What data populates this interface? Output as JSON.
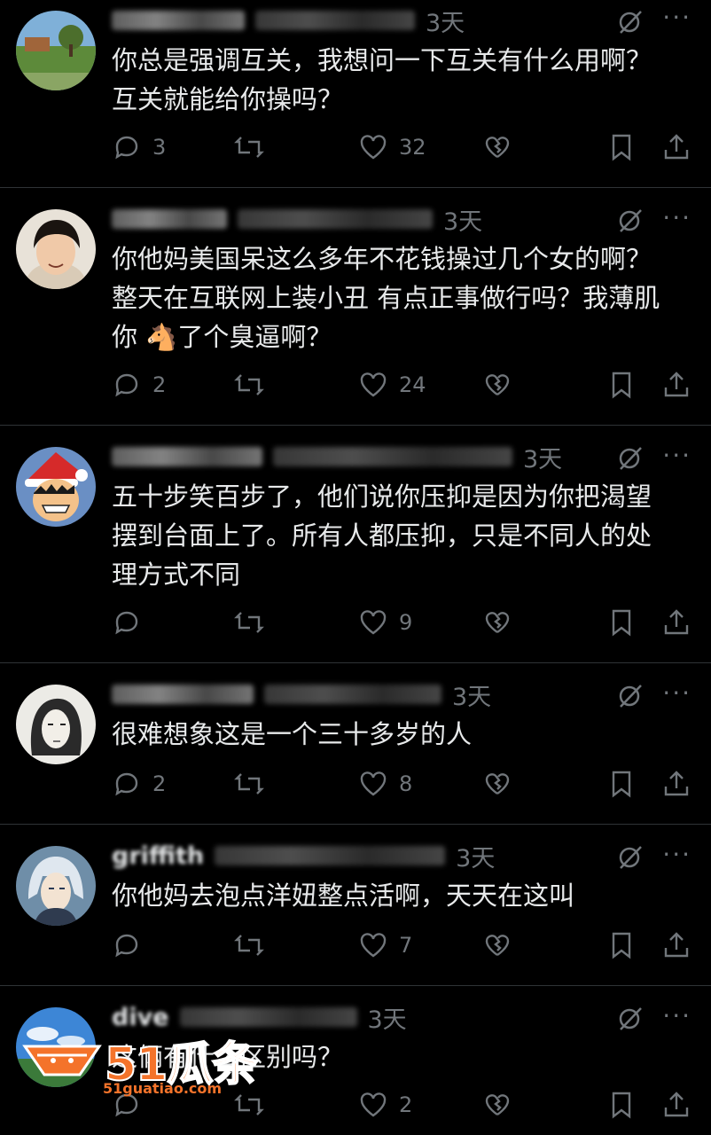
{
  "tweets": [
    {
      "time": "3天",
      "text": [
        "你总是强调互关，我想问一下互关有什么用啊？",
        "互关就能给你操吗？"
      ],
      "replies": "3",
      "retweets": "",
      "likes": "32",
      "avatar": "landscape"
    },
    {
      "time": "3天",
      "text": [
        "你他妈美国呆这么多年不花钱操过几个女的啊？",
        "整天在互联网上装小丑 有点正事做行吗？我薄肌",
        "你 🐴了个臭逼啊？"
      ],
      "replies": "2",
      "retweets": "",
      "likes": "24",
      "avatar": "person"
    },
    {
      "time": "3天",
      "text": [
        "五十步笑百步了，他们说你压抑是因为你把渴望",
        "摆到台面上了。所有人都压抑，只是不同人的处",
        "理方式不同"
      ],
      "replies": "",
      "retweets": "",
      "likes": "9",
      "avatar": "anime-santa"
    },
    {
      "time": "3天",
      "text": [
        "很难想象这是一个三十多岁的人"
      ],
      "replies": "2",
      "retweets": "",
      "likes": "8",
      "avatar": "sketch-face"
    },
    {
      "time": "3天",
      "name": "griffith",
      "text": [
        "你他妈去泡点洋妞整点活啊，天天在这叫"
      ],
      "replies": "",
      "retweets": "",
      "likes": "7",
      "avatar": "anime-white-hair"
    },
    {
      "time": "3天",
      "name": "dive",
      "text": [
        "这俩有什么区别吗？"
      ],
      "replies": "",
      "retweets": "",
      "likes": "2",
      "avatar": "sky"
    }
  ],
  "watermark": {
    "brand": "51瓜条",
    "url": "51guatiao.com"
  },
  "icons": [
    "reply-icon",
    "retweet-icon",
    "like-icon",
    "grok-icon",
    "bookmark-icon",
    "share-icon",
    "more-icon"
  ],
  "colors": {
    "background": "#000000",
    "text": "#e7e9ea",
    "muted": "#71767b",
    "divider": "#2f3336",
    "watermark": "#f4732a"
  }
}
